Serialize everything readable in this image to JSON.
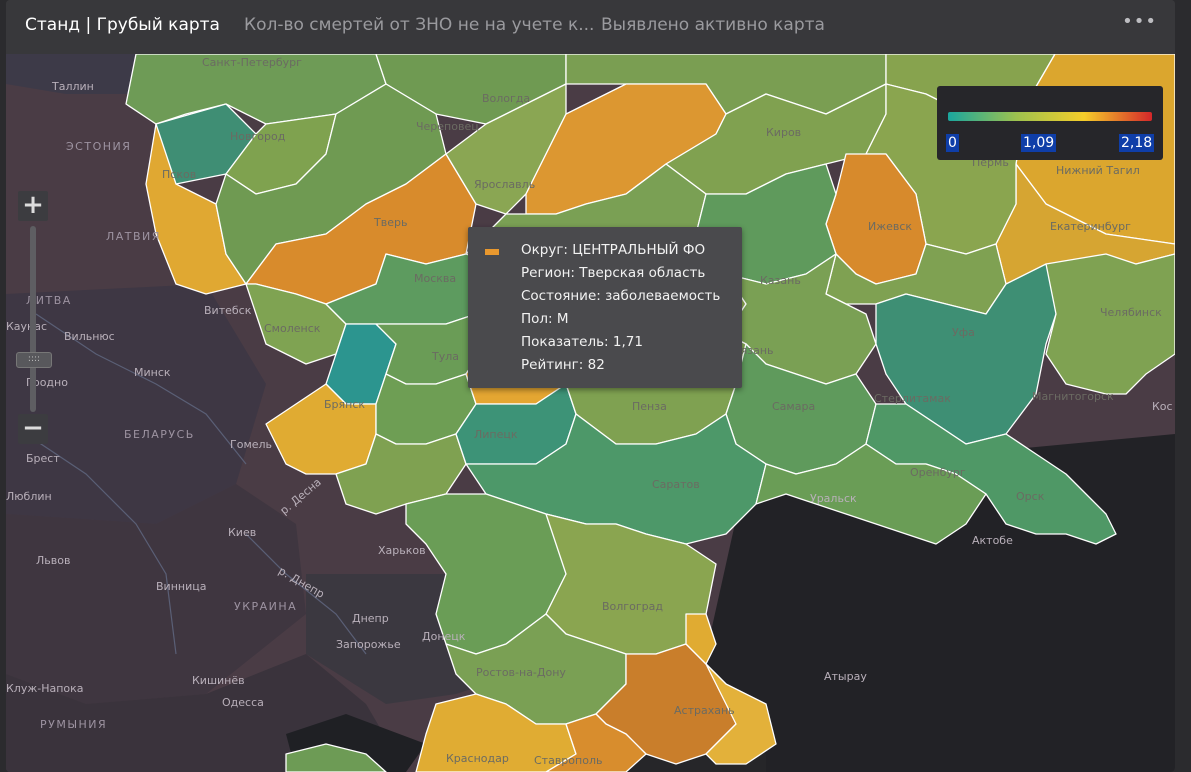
{
  "tabs": [
    {
      "label": "Станд | Грубый карта"
    },
    {
      "label": "Кол-во смертей от ЗНО не на учете к..."
    },
    {
      "label": "Выявлено активно карта"
    }
  ],
  "more_icon": "ellipsis-icon",
  "zoom": {
    "in_label": "+",
    "out_label": "−",
    "handle_label": "::::"
  },
  "legend": {
    "min": "0",
    "mid": "1,09",
    "max": "2,18",
    "colors": [
      "#1aa69e",
      "#9dc24f",
      "#f5cd2a",
      "#d4272a"
    ]
  },
  "tooltip": {
    "swatch_color": "#e9982e",
    "district": "Округ: ЦЕНТРАЛЬНЫЙ ФО",
    "region": "Регион: Тверская область",
    "state": "Состояние: заболеваемость",
    "sex": "Пол: М",
    "value": "Показатель: 1,71",
    "rating": "Рейтинг: 82"
  },
  "map_labels": {
    "tallinn": "Таллин",
    "estonia": "ЭСТОНИЯ",
    "latvia": "ЛАТВИЯ",
    "lithuania": "ЛИТВА",
    "kaunas": "Каунас",
    "vilnius": "Вильнюс",
    "minsk": "Минск",
    "grodno": "Гродно",
    "belarus": "БЕЛАРУСЬ",
    "vitebsk": "Витебск",
    "gomel": "Гомель",
    "brest": "Брест",
    "lublin": "Люблин",
    "kiev": "Киев",
    "lvov": "Львов",
    "vinnitsa": "Винница",
    "ukraine": "УКРАИНА",
    "dnepr": "Днепр",
    "zaporozhye": "Запорожье",
    "donetsk": "Донецк",
    "kishinev": "Кишинёв",
    "odessa": "Одесса",
    "cluj": "Клуж-Напока",
    "romania": "РУМЫНИЯ",
    "kharkov": "Харьков",
    "desna": "р. Десна",
    "dnepr_river": "р. Днепр",
    "petersburg": "Санкт-Петербург",
    "vologda": "Вологда",
    "kirov": "Киров",
    "perm": "Пермь",
    "tagil": "Нижний Тагил",
    "ekaterinburg": "Екатеринбург",
    "izhevsk": "Ижевск",
    "kazan": "Казань",
    "ufa": "Уфа",
    "chelyabinsk": "Челябинск",
    "magnitogorsk": "Магнитогорск",
    "sterlitamak": "Стерлитамак",
    "samara": "Самара",
    "penza": "Пенза",
    "saratov": "Саратов",
    "orenburg": "Оренбург",
    "orsk": "Орск",
    "uralsk": "Уральск",
    "aktobe": "Актобе",
    "volgograd": "Волгоград",
    "rostov": "Ростов-на-Дону",
    "astrakhan": "Астрахань",
    "atyrau": "Атырау",
    "krasnodar": "Краснодар",
    "stavropol": "Ставрополь",
    "kostanay": "Кос",
    "moscow": "Москва",
    "tver": "Тверь",
    "yaroslavl": "Ярославль",
    "smolensk": "Смоленск",
    "bryansk": "Брянск",
    "lipetsk": "Липецк",
    "pskov": "Псков",
    "novgorod": "Новгород",
    "cherepovets": "Череповец",
    "tula": "Тула",
    "ryazan": "Рязань"
  }
}
